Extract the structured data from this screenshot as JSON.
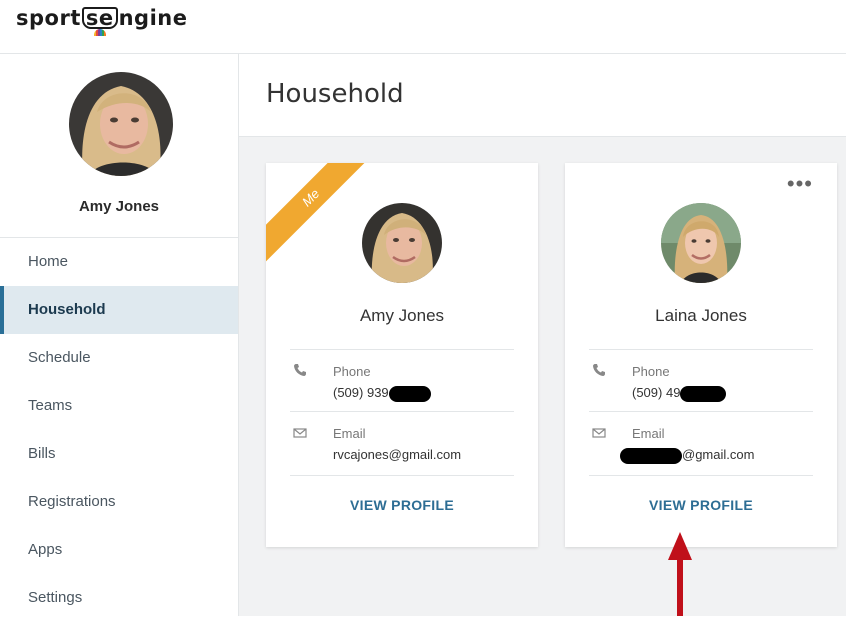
{
  "brand": {
    "logo_text_left": "sport",
    "logo_text_mid": "se",
    "logo_text_right": "ngine"
  },
  "user": {
    "name": "Amy Jones"
  },
  "nav": {
    "items": [
      {
        "label": "Home"
      },
      {
        "label": "Household"
      },
      {
        "label": "Schedule"
      },
      {
        "label": "Teams"
      },
      {
        "label": "Bills"
      },
      {
        "label": "Registrations"
      },
      {
        "label": "Apps"
      },
      {
        "label": "Settings"
      }
    ],
    "active": "Household"
  },
  "page": {
    "title": "Household"
  },
  "cards": [
    {
      "ribbon": "Me",
      "name": "Amy Jones",
      "phone_label": "Phone",
      "phone_value": "(509) 939",
      "email_label": "Email",
      "email_value": "rvcajones@gmail.com",
      "action": "VIEW PROFILE"
    },
    {
      "name": "Laina Jones",
      "phone_label": "Phone",
      "phone_value": "(509) 49",
      "email_label": "Email",
      "email_value": "@gmail.com",
      "action": "VIEW PROFILE"
    }
  ],
  "colors": {
    "accent": "#2d6d94",
    "ribbon": "#f0a830",
    "active_nav_bg": "#dfe9ef",
    "annotation_arrow": "#c0101a"
  },
  "icons": [
    "phone-icon",
    "mail-icon",
    "more-options-icon"
  ]
}
